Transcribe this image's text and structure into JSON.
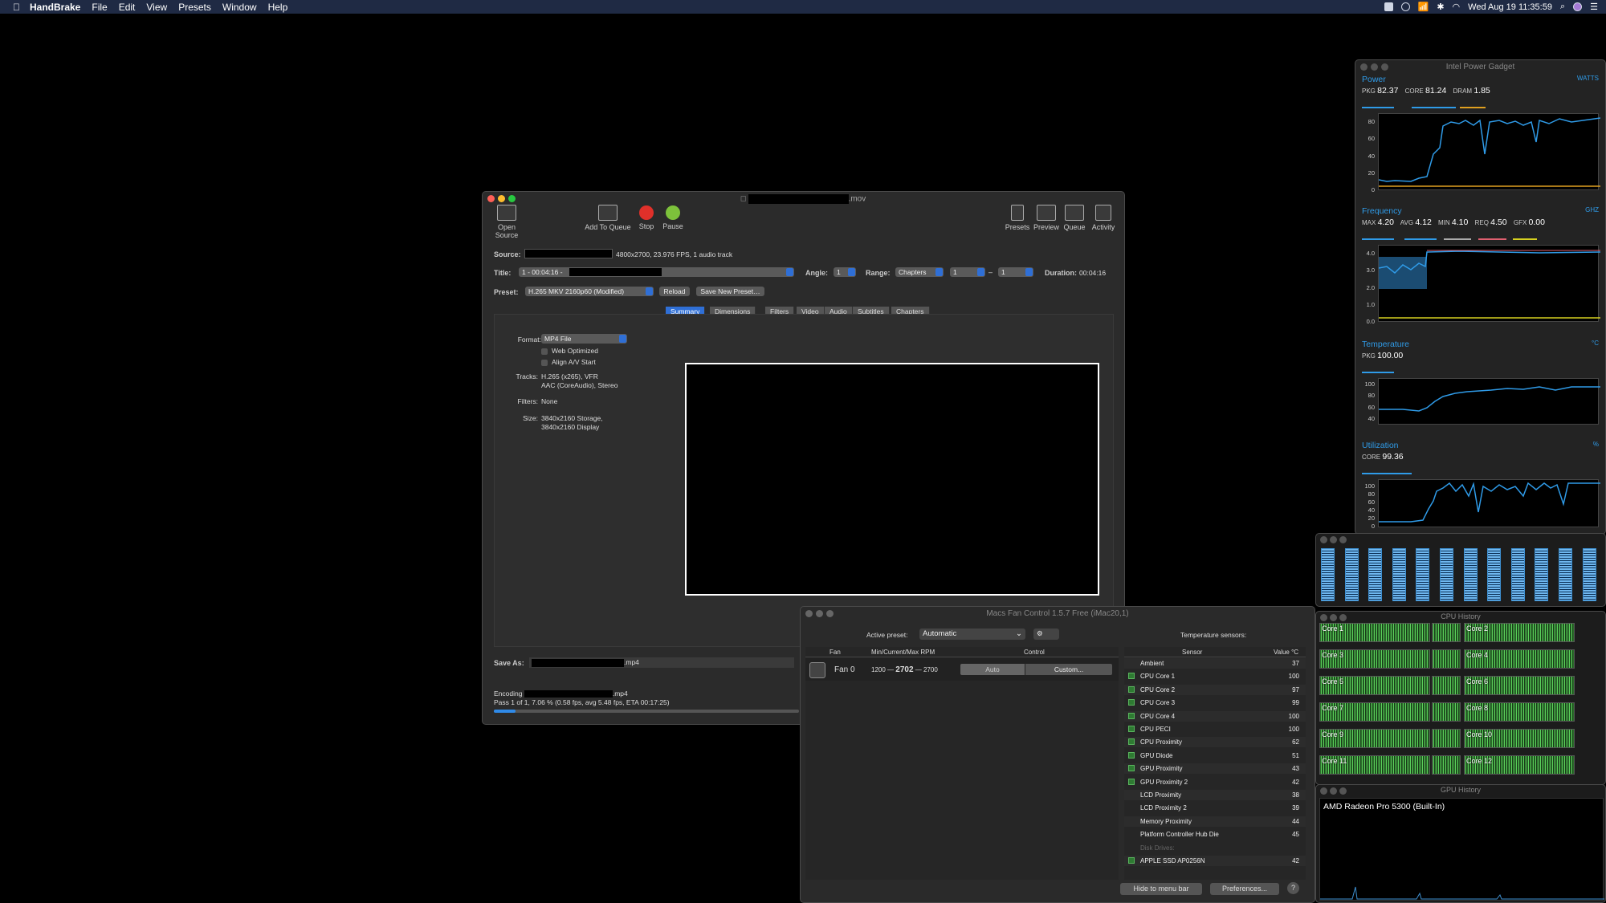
{
  "menubar": {
    "app": "HandBrake",
    "menus": [
      "File",
      "Edit",
      "View",
      "Presets",
      "Window",
      "Help"
    ],
    "clock": "Wed Aug 19  11:35:59"
  },
  "handbrake": {
    "title": ".mov",
    "toolbar": {
      "open_source": "Open Source",
      "add_to_queue": "Add To Queue",
      "stop": "Stop",
      "pause": "Pause",
      "presets": "Presets",
      "preview": "Preview",
      "queue": "Queue",
      "activity": "Activity"
    },
    "source_label": "Source:",
    "source_value": "4800x2700, 23.976 FPS, 1 audio track",
    "title_label": "Title:",
    "title_value": "1 - 00:04:16 -",
    "angle_label": "Angle:",
    "angle_value": "1",
    "range_label": "Range:",
    "range_type": "Chapters",
    "range_from": "1",
    "range_dash": "–",
    "range_to": "1",
    "duration_label": "Duration:",
    "duration_value": "00:04:16",
    "preset_label": "Preset:",
    "preset_value": "H.265 MKV 2160p60 (Modified)",
    "reload": "Reload",
    "save_new_preset": "Save New Preset…",
    "tabs": [
      "Summary",
      "Dimensions",
      "Filters",
      "Video",
      "Audio",
      "Subtitles",
      "Chapters"
    ],
    "format_label": "Format:",
    "format_value": "MP4 File",
    "web_optimized": "Web Optimized",
    "align_av": "Align A/V Start",
    "tracks_label": "Tracks:",
    "tracks_1": "H.265 (x265), VFR",
    "tracks_2": "AAC (CoreAudio), Stereo",
    "filters_label": "Filters:",
    "filters_value": "None",
    "size_label": "Size:",
    "size_1": "3840x2160 Storage,",
    "size_2": "3840x2160 Display",
    "save_as_label": "Save As:",
    "save_as_ext": ".mp4",
    "encoding_label": "Encoding",
    "encoding_ext": ".mp4",
    "progress_text": "Pass 1 of 1, 7.06 % (0.58 fps, avg 5.48 fps, ETA 00:17:25)",
    "progress": 0.0706
  },
  "fan": {
    "title": "Macs Fan Control 1.5.7 Free (iMac20,1)",
    "active_preset_label": "Active preset:",
    "active_preset": "Automatic",
    "temp_sensors_label": "Temperature sensors:",
    "col_fan": "Fan",
    "col_rpm": "Min/Current/Max RPM",
    "col_control": "Control",
    "col_sensor": "Sensor",
    "col_value": "Value °C",
    "fan_name": "Fan 0",
    "fan_min": "1200",
    "fan_cur": "2702",
    "fan_max": "2700",
    "fan_sep": "—",
    "auto": "Auto",
    "custom": "Custom...",
    "sensors": [
      {
        "name": "Ambient",
        "value": "37"
      },
      {
        "name": "CPU Core 1",
        "value": "100"
      },
      {
        "name": "CPU Core 2",
        "value": "97"
      },
      {
        "name": "CPU Core 3",
        "value": "99"
      },
      {
        "name": "CPU Core 4",
        "value": "100"
      },
      {
        "name": "CPU PECI",
        "value": "100"
      },
      {
        "name": "CPU Proximity",
        "value": "62"
      },
      {
        "name": "GPU Diode",
        "value": "51"
      },
      {
        "name": "GPU Proximity",
        "value": "43"
      },
      {
        "name": "GPU Proximity 2",
        "value": "42"
      },
      {
        "name": "LCD Proximity",
        "value": "38"
      },
      {
        "name": "LCD Proximity 2",
        "value": "39"
      },
      {
        "name": "Memory Proximity",
        "value": "44"
      },
      {
        "name": "Platform Controller Hub Die",
        "value": "45"
      }
    ],
    "disk_drives_label": "Disk Drives:",
    "disk": {
      "name": "APPLE SSD AP0256N",
      "value": "42"
    },
    "hide_btn": "Hide to menu bar",
    "prefs_btn": "Preferences...",
    "help": "?"
  },
  "gadget": {
    "title": "Intel Power Gadget",
    "power": {
      "head": "Power",
      "unit": "WATTS",
      "pkg_l": "PKG",
      "pkg": "82.37",
      "core_l": "CORE",
      "core": "81.24",
      "dram_l": "DRAM",
      "dram": "1.85",
      "ticks": [
        "80",
        "60",
        "40",
        "20",
        "0"
      ]
    },
    "freq": {
      "head": "Frequency",
      "unit": "GHZ",
      "max_l": "MAX",
      "max": "4.20",
      "avg_l": "AVG",
      "avg": "4.12",
      "min_l": "MIN",
      "min": "4.10",
      "req_l": "REQ",
      "req": "4.50",
      "gfx_l": "GFX",
      "gfx": "0.00",
      "ticks": [
        "4.0",
        "3.0",
        "2.0",
        "1.0",
        "0.0"
      ]
    },
    "temp": {
      "head": "Temperature",
      "unit": "°C",
      "pkg_l": "PKG",
      "pkg": "100.00",
      "ticks": [
        "100",
        "80",
        "60",
        "40"
      ]
    },
    "util": {
      "head": "Utilization",
      "unit": "%",
      "core_l": "CORE",
      "core": "99.36",
      "ticks": [
        "100",
        "80",
        "60",
        "40",
        "20",
        "0"
      ]
    }
  },
  "cpu_history": {
    "title": "CPU History",
    "cores": [
      "Core 1",
      "Core 2",
      "Core 3",
      "Core 4",
      "Core 5",
      "Core 6",
      "Core 7",
      "Core 8",
      "Core 9",
      "Core 10",
      "Core 11",
      "Core 12"
    ]
  },
  "gpu_history": {
    "title": "GPU History",
    "gpu_name": "AMD Radeon Pro 5300 (Built-In)"
  },
  "colors": {
    "accent": "#2f9be8",
    "stop": "#e0302a",
    "pause": "#7dc23b"
  }
}
